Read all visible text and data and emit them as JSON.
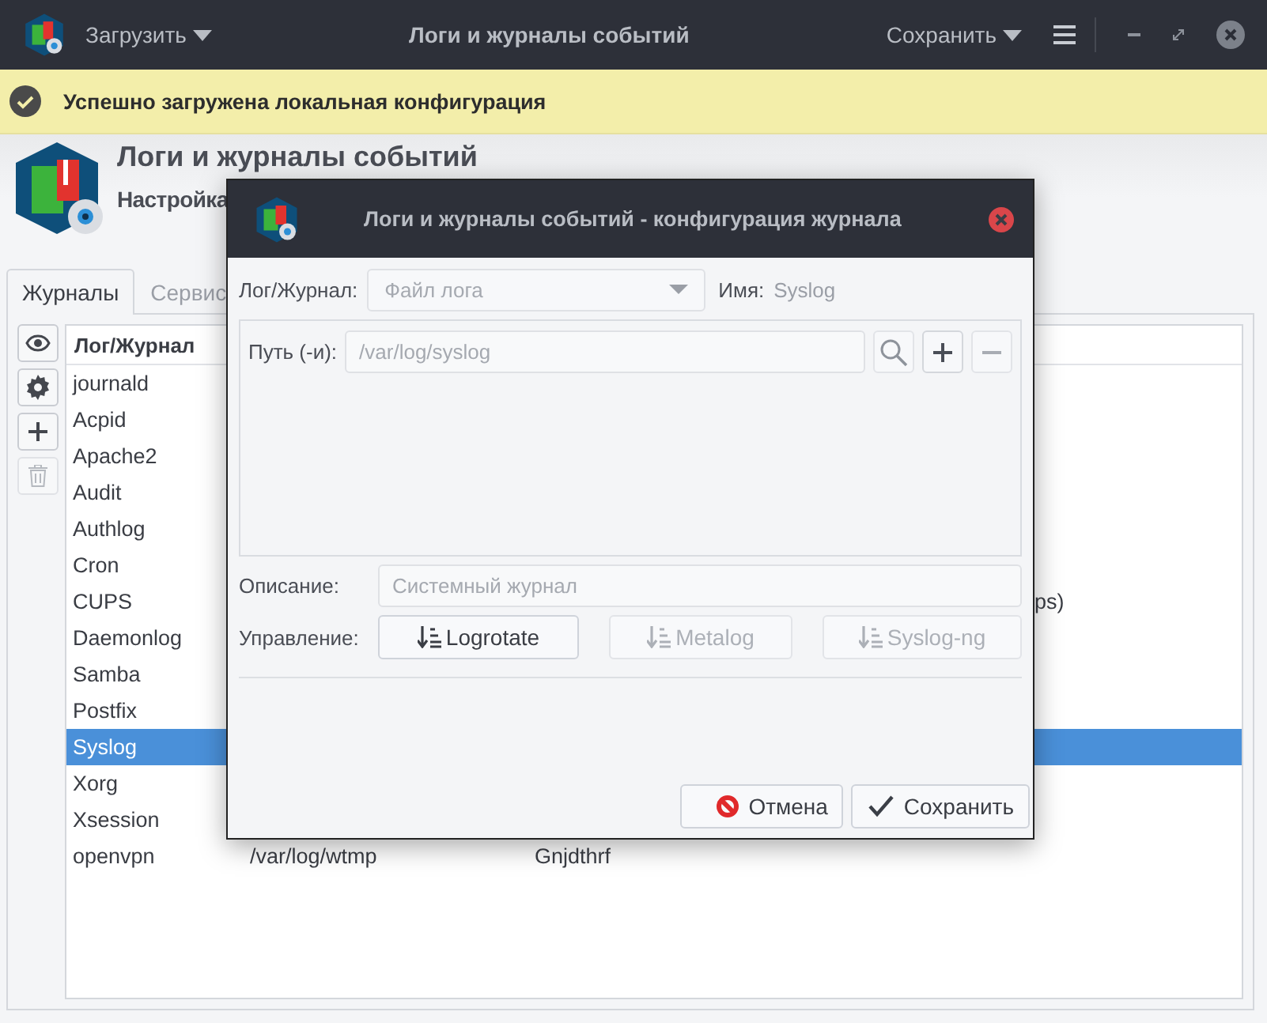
{
  "header": {
    "load_menu": "Загрузить",
    "title": "Логи и журналы событий",
    "save_menu": "Сохранить"
  },
  "infobar": {
    "message": "Успешно загружена локальная конфигурация"
  },
  "app": {
    "title": "Логи и журналы событий",
    "subtitle": "Настройка"
  },
  "tabs": [
    {
      "label": "Журналы",
      "selected": true
    },
    {
      "label": "Сервис",
      "selected": false
    }
  ],
  "toolbar": [
    {
      "kind": "view",
      "disabled": false
    },
    {
      "kind": "settings",
      "disabled": false
    },
    {
      "kind": "add",
      "disabled": false
    },
    {
      "kind": "delete",
      "disabled": true
    }
  ],
  "table": {
    "columns": [
      "Лог/Журнал"
    ],
    "rows": [
      {
        "name": "journald",
        "selected": false
      },
      {
        "name": "Acpid",
        "selected": false
      },
      {
        "name": "Apache2",
        "selected": false
      },
      {
        "name": "Audit",
        "selected": false
      },
      {
        "name": "Authlog",
        "selected": false
      },
      {
        "name": "Cron",
        "selected": false
      },
      {
        "name": "CUPS",
        "tail": "ps)",
        "selected": false
      },
      {
        "name": "Daemonlog",
        "selected": false
      },
      {
        "name": "Samba",
        "selected": false
      },
      {
        "name": "Postfix",
        "selected": false
      },
      {
        "name": "Syslog",
        "selected": true
      },
      {
        "name": "Xorg",
        "selected": false
      },
      {
        "name": "Xsession",
        "selected": false
      },
      {
        "name": "openvpn",
        "path": "/var/log/wtmp",
        "description": "Gnjdthrf",
        "selected": false
      }
    ]
  },
  "dialog": {
    "title": "Логи и журналы событий - конфигурация журнала",
    "type_label": "Лог/Журнал:",
    "type_value": "Файл лога",
    "name_label": "Имя:",
    "name_value": "Syslog",
    "path_label": "Путь (-и):",
    "path_value": "/var/log/syslog",
    "description_label": "Описание:",
    "description_placeholder": "Системный журнал",
    "control_label": "Управление:",
    "controls": [
      {
        "label": "Logrotate",
        "disabled": false
      },
      {
        "label": "Metalog",
        "disabled": true
      },
      {
        "label": "Syslog-ng",
        "disabled": true
      }
    ],
    "cancel": "Отмена",
    "save": "Сохранить"
  }
}
